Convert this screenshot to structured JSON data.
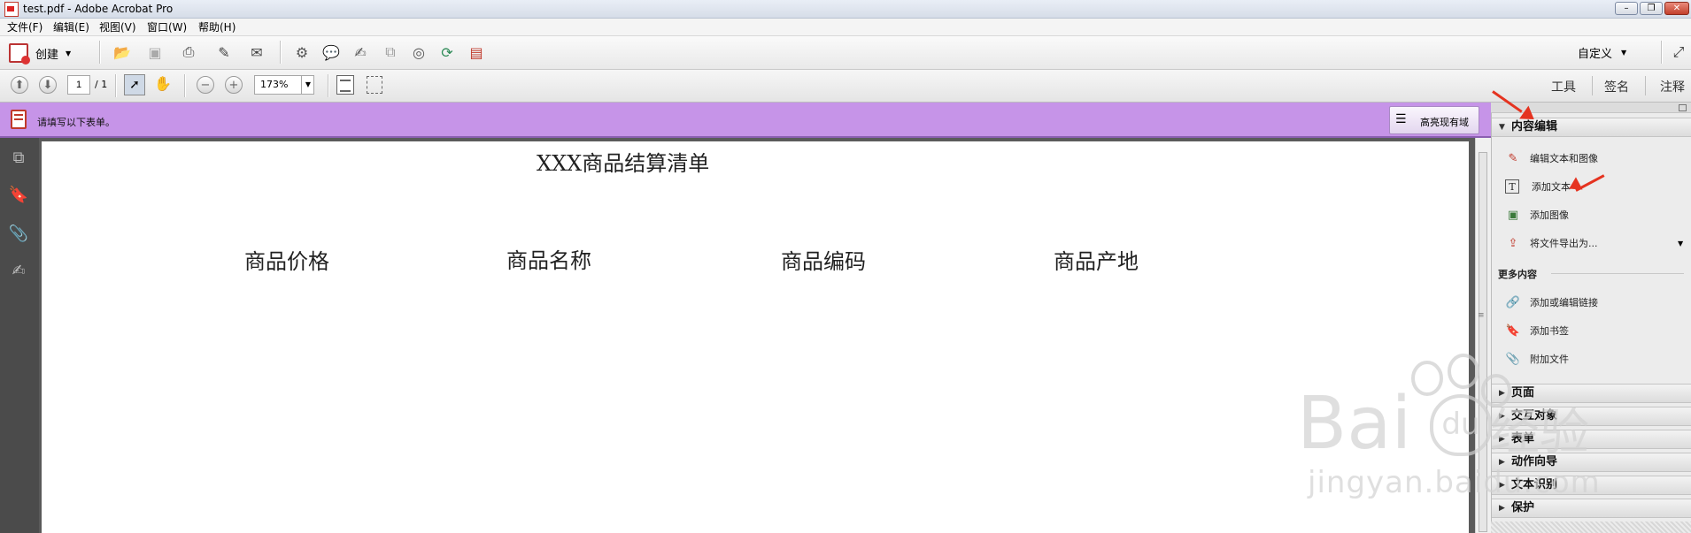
{
  "window": {
    "title": "test.pdf - Adobe Acrobat Pro",
    "controls": [
      "minimize",
      "restore",
      "close"
    ]
  },
  "menu": [
    "文件(F)",
    "编辑(E)",
    "视图(V)",
    "窗口(W)",
    "帮助(H)"
  ],
  "toolbar": {
    "create_label": "创建",
    "customize_label": "自定义",
    "icons": [
      "create-icon",
      "open-icon",
      "save-icon",
      "print-icon",
      "edit-icon",
      "email-icon",
      "settings-icon",
      "comment-icon",
      "sign-icon",
      "combine-icon",
      "scan-icon",
      "export-icon",
      "forms-icon",
      "expand-icon"
    ]
  },
  "nav": {
    "page_current": "1",
    "page_total": "/ 1",
    "zoom": "173%"
  },
  "pane_links": {
    "tools": "工具",
    "sign": "签名",
    "comment": "注释"
  },
  "notice": {
    "text": "请填写以下表单。",
    "highlight_button": "高亮现有域",
    "color": "#c694e8"
  },
  "document": {
    "title": "XXX商品结算清单",
    "columns": [
      "商品价格",
      "商品名称",
      "商品编码",
      "商品产地"
    ]
  },
  "right_panel": {
    "content_editing": {
      "title": "内容编辑",
      "items": [
        "编辑文本和图像",
        "添加文本",
        "添加图像",
        "将文件导出为..."
      ]
    },
    "more_content": {
      "title": "更多内容",
      "items": [
        "添加或编辑链接",
        "添加书签",
        "附加文件"
      ]
    },
    "collapsed_sections": [
      "页面",
      "交互对象",
      "表单",
      "动作向导",
      "文本识别",
      "保护"
    ]
  },
  "annotation_color": "#e53320",
  "watermark": {
    "text_line1": "Bai",
    "text_line2": "经验",
    "text_line3": "jingyan.baidu.com"
  }
}
